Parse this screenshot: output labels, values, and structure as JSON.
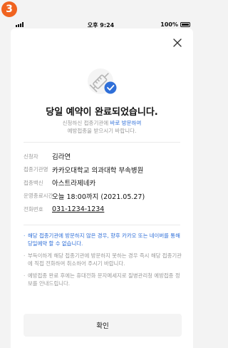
{
  "step_badge": "3",
  "status_bar": {
    "time": "오후 9:24",
    "battery": "100%"
  },
  "dialog": {
    "title": "당일 예약이 완료되었습니다.",
    "subtitle_line1_prefix": "신청하신 접종기관에 ",
    "subtitle_line1_link": "바로 방문하여",
    "subtitle_line2": "예방접종을 받으시기 바랍니다.",
    "info": [
      {
        "label": "신청자",
        "value": "김라연"
      },
      {
        "label": "접종기관명",
        "value": "카카오대학교 의과대학 부속병원"
      },
      {
        "label": "접종백신",
        "value": "아스트라제네카"
      },
      {
        "label": "운영종료시간",
        "value": "오늘 18:00까지 (2021.05.27)"
      },
      {
        "label": "전화번호",
        "value": "031-1234-1234"
      }
    ],
    "notes": [
      {
        "text": "해당 접종기관에 방문하지 않은 경우, 향후 카카오 또는 네이버를 통해 당일예약 할 수 없습니다.",
        "highlight": true
      },
      {
        "text": "부득이하게 해당 접종기관에 방문하지 못하는 경우 즉시 해당 접종기관에 직접 전화하여 취소하어 주시기 바랍니다.",
        "highlight": false
      },
      {
        "text": "예방접종 완료 후에는 휴대전화 문자메세지로 질병관리청 예방접종 정보를 안내드립니다.",
        "highlight": false
      }
    ],
    "confirm_label": "확인"
  },
  "colors": {
    "badge": "#f0631f",
    "accent": "#2f6fd8",
    "muted": "#9a9a9a"
  },
  "icons": {
    "close": "close-icon",
    "illustration": "syringe-check-icon"
  }
}
